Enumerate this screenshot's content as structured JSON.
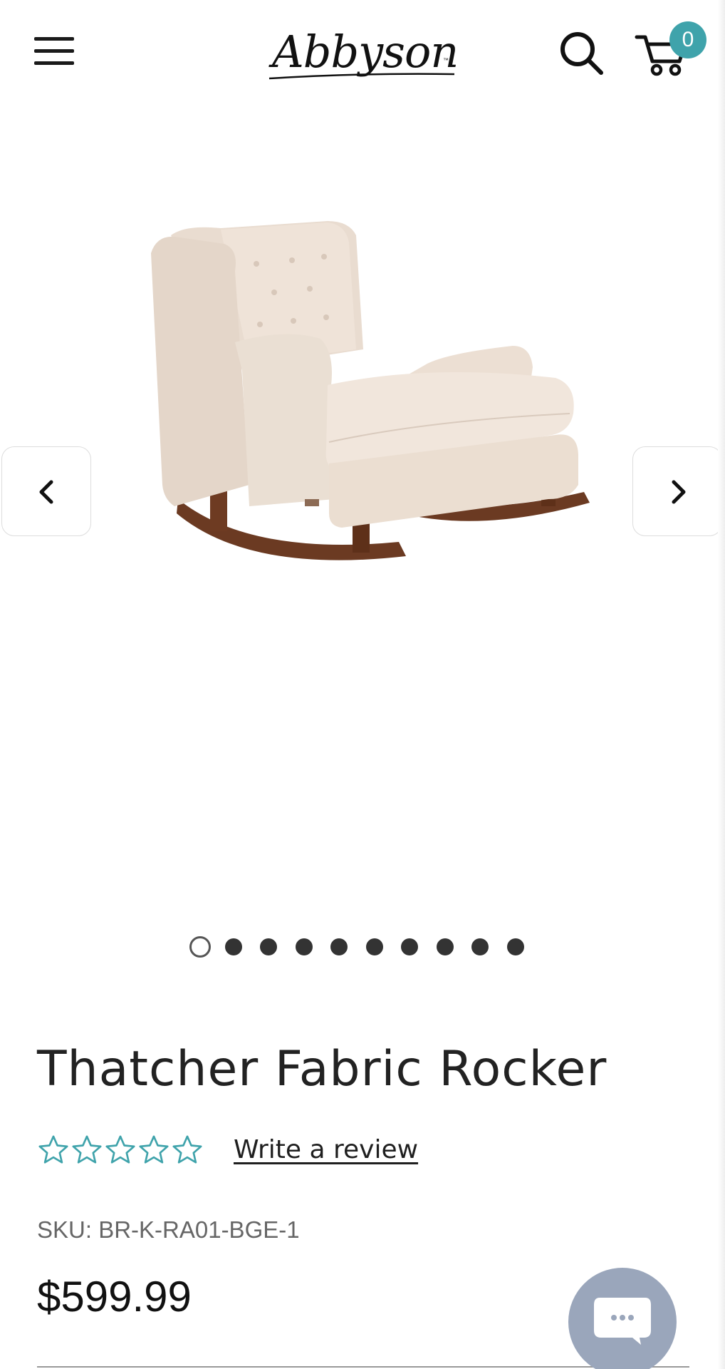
{
  "header": {
    "logo_text": "Abbyson",
    "logo_tm": "™",
    "cart_count": "0"
  },
  "gallery": {
    "image_alt": "Thatcher Fabric Rocker",
    "slide_count": 10,
    "active_index": 0
  },
  "product": {
    "title": "Thatcher Fabric Rocker",
    "rating": {
      "stars_filled": 0,
      "stars_total": 5,
      "write_review_label": "Write a review"
    },
    "sku": "SKU: BR-K-RA01-BGE-1",
    "price": "$599.99"
  },
  "colors": {
    "accent": "#3fa3ab",
    "star_outline": "#3fa3ab",
    "chat_button": "#9aa6bb"
  },
  "icons": {
    "menu": "hamburger-icon",
    "search": "search-icon",
    "cart": "cart-icon",
    "prev": "chevron-left-icon",
    "next": "chevron-right-icon",
    "chat": "chat-bubble-icon"
  }
}
